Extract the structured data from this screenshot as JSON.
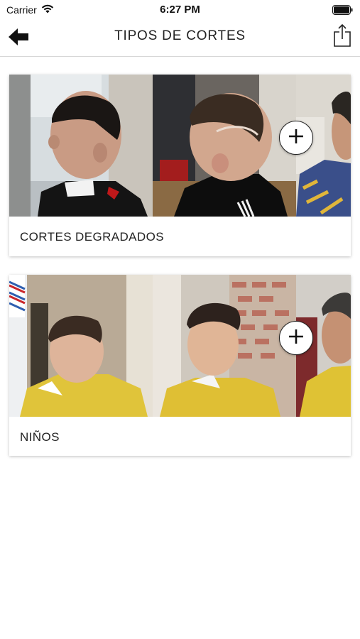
{
  "status_bar": {
    "carrier": "Carrier",
    "time": "6:27 PM"
  },
  "nav": {
    "title": "TIPOS DE CORTES"
  },
  "cards": [
    {
      "caption": "CORTES DEGRADADOS",
      "icon": "plus-icon"
    },
    {
      "caption": "NIÑOS",
      "icon": "plus-icon"
    }
  ],
  "icons": [
    "wifi-icon",
    "battery-icon",
    "back-arrow-icon",
    "share-icon",
    "plus-icon"
  ]
}
